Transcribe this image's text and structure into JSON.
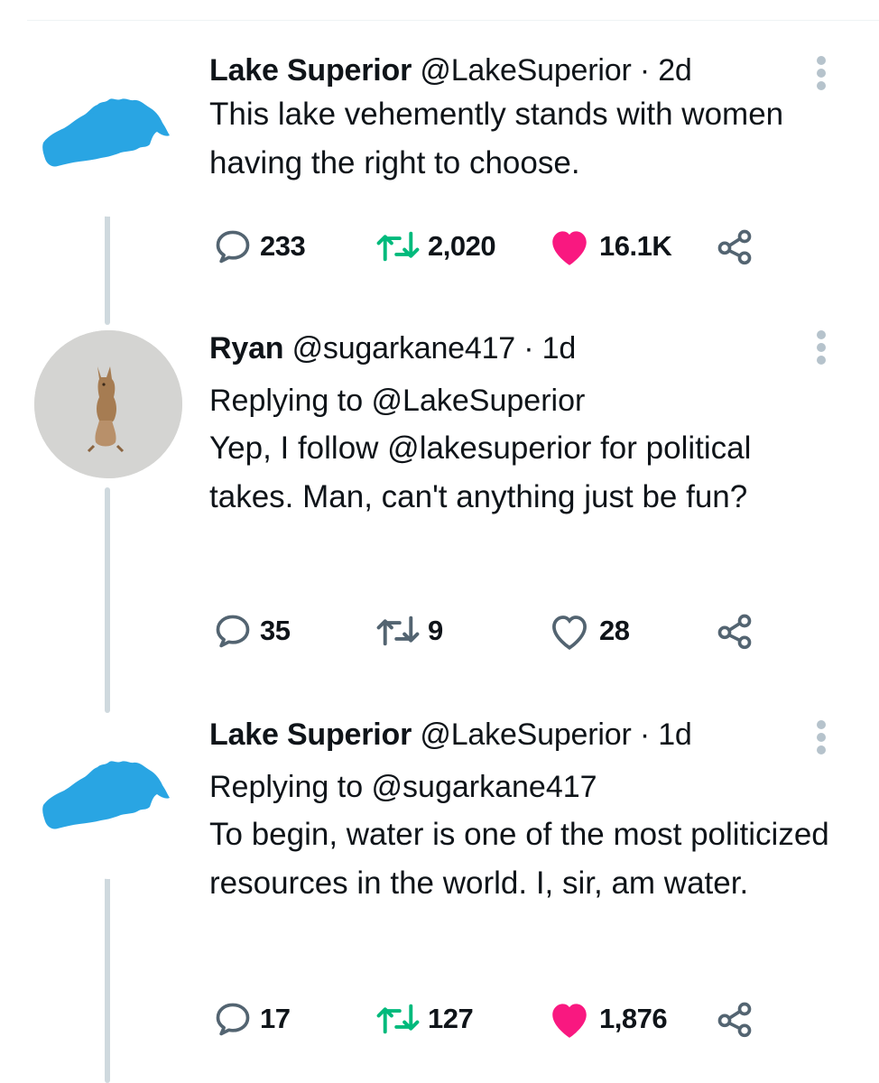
{
  "tweets": [
    {
      "name": "Lake Superior",
      "handle": "@LakeSuperior",
      "separator": "·",
      "time": "2d",
      "replying_to": "",
      "text": "This lake vehemently stands with women having the right to choose.",
      "avatar_icon": "lake-superior-map-icon",
      "replies": "233",
      "retweets": "2,020",
      "likes": "16.1K",
      "liked": true,
      "colors": {
        "retweet": "#00ba7c",
        "like": "#f91880"
      }
    },
    {
      "name": "Ryan",
      "handle": "@sugarkane417",
      "separator": "·",
      "time": "1d",
      "replying_to": "Replying to @LakeSuperior",
      "text": "Yep, I follow @lakesuperior for political takes.  Man, can't anything just be fun?",
      "avatar_icon": "kangaroo-icon",
      "replies": "35",
      "retweets": "9",
      "likes": "28",
      "liked": false
    },
    {
      "name": "Lake Superior",
      "handle": "@LakeSuperior",
      "separator": "·",
      "time": "1d",
      "replying_to": "Replying to @sugarkane417",
      "text": "To begin, water is one of the most politicized resources in the world. I, sir, am water.",
      "avatar_icon": "lake-superior-map-icon",
      "replies": "17",
      "retweets": "127",
      "likes": "1,876",
      "liked": true
    }
  ]
}
